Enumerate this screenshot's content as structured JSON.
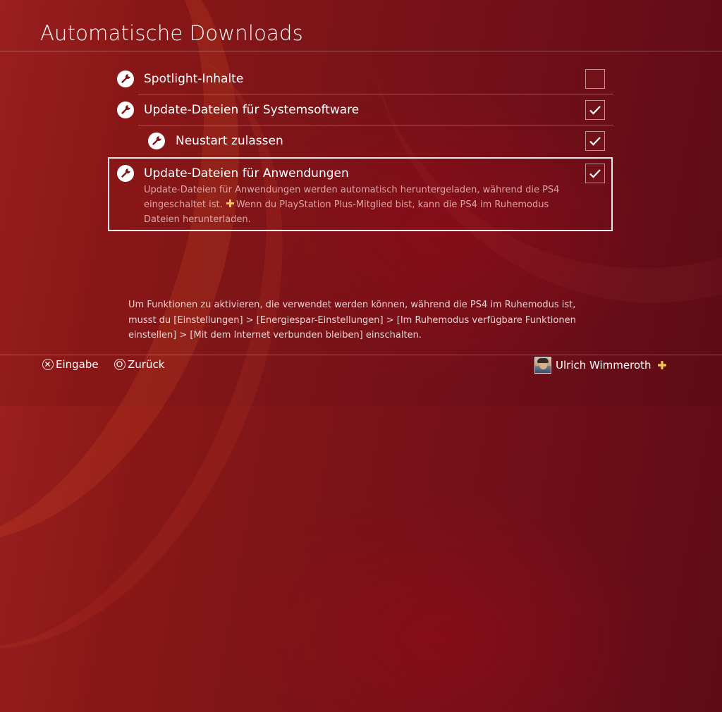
{
  "page": {
    "title": "Automatische Downloads"
  },
  "colors": {
    "accent_plus": "#f2c94c",
    "selection_border": "#f3eeee"
  },
  "settings": [
    {
      "label": "Spotlight-Inhalte",
      "checked": false,
      "icon": "wrench-icon"
    },
    {
      "label": "Update-Dateien für Systemsoftware",
      "checked": true,
      "icon": "wrench-icon"
    },
    {
      "label": "Neustart zulassen",
      "checked": true,
      "icon": "wrench-icon",
      "indented": true
    },
    {
      "label": "Update-Dateien für Anwendungen",
      "checked": true,
      "icon": "wrench-icon",
      "focused": true,
      "description_part1": "Update-Dateien für Anwendungen werden automatisch heruntergeladen, während die PS4 eingeschaltet ist.",
      "description_part2": "Wenn du PlayStation Plus-Mitglied bist, kann die PS4 im Ruhemodus Dateien herunterladen."
    }
  ],
  "info_text": "Um Funktionen zu aktivieren, die verwendet werden können, während die PS4 im Ruhemodus ist, musst du [Einstellungen] > [Energiespar-Einstellungen] > [Im Ruhemodus verfügbare Funktionen einstellen] > [Mit dem Internet verbunden bleiben] einschalten.",
  "footer": {
    "enter_label": "Eingabe",
    "back_label": "Zurück",
    "user_name": "Ulrich Wimmeroth"
  }
}
